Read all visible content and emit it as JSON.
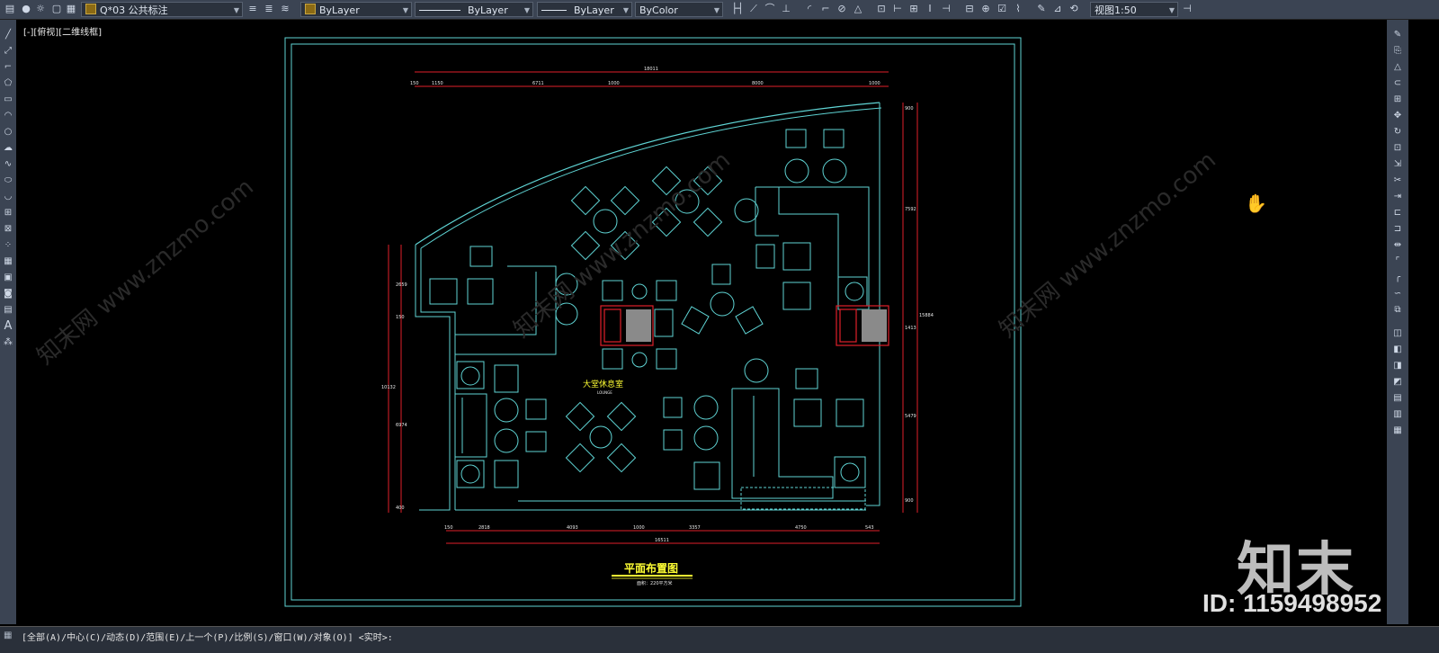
{
  "toolbar": {
    "layer_name": "Q*03 公共标注",
    "color": "ByLayer",
    "linetype": "ByLayer",
    "lineweight": "ByLayer",
    "plotstyle": "ByColor",
    "scale": "视图1:50"
  },
  "viewport": {
    "label": "[-][俯视][二维线框]"
  },
  "drawing": {
    "title": "平面布置图",
    "subtitle": "面积：220平方米",
    "room_label": "大堂休息室",
    "room_label_en": "LOUNGE",
    "dims_top": {
      "overall": "18011",
      "segments": [
        "150",
        "1150",
        "6711",
        "1000",
        "8000",
        "1000"
      ]
    },
    "dims_bottom": {
      "overall": "16511",
      "segments": [
        "150",
        "2818",
        "4093",
        "1000",
        "3357",
        "4750",
        "543"
      ]
    },
    "dims_right": {
      "overall": "15884",
      "segments": [
        "900",
        "7592",
        "1413",
        "5479",
        "900"
      ]
    },
    "dims_left": {
      "overall": "10132",
      "segments": [
        "2659",
        "150",
        "6974",
        "400"
      ]
    }
  },
  "command_line": {
    "text": "[全部(A)/中心(C)/动态(D)/范围(E)/上一个(P)/比例(S)/窗口(W)/对象(O)] <实时>:"
  },
  "watermark": {
    "logo": "知末",
    "id": "ID: 1159498952",
    "site": "知末网 www.znzmo.com"
  },
  "colors": {
    "toolbar_bg": "#3b4453",
    "canvas_bg": "#000000",
    "cad_cyan": "#5fd4d4",
    "cad_red": "#e0202a",
    "cad_yellow": "#ffff33"
  }
}
